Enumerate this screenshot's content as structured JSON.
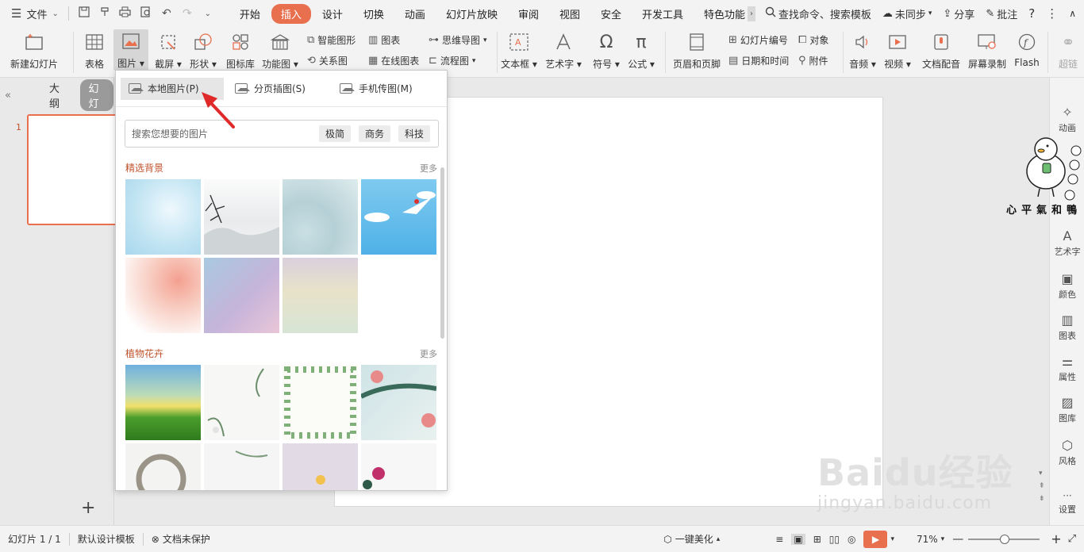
{
  "menubar": {
    "file_label": "文件",
    "tabs": [
      "开始",
      "插入",
      "设计",
      "切换",
      "动画",
      "幻灯片放映",
      "审阅",
      "视图",
      "安全",
      "开发工具",
      "特色功能"
    ],
    "active_tab": "插入",
    "search_placeholder": "查找命令、搜索模板",
    "sync_label": "未同步",
    "share_label": "分享",
    "comment_label": "批注"
  },
  "ribbon": {
    "new_slide": "新建幻灯片",
    "table": "表格",
    "picture": "图片",
    "screenshot": "截屏",
    "shape": "形状",
    "icon_lib": "图标库",
    "func_chart": "功能图",
    "smart_shape": "智能图形",
    "chart": "图表",
    "relation": "关系图",
    "online_chart": "在线图表",
    "mind_map": "思维导图",
    "flow_chart": "流程图",
    "text_box": "文本框",
    "art_text": "艺术字",
    "symbol": "符号",
    "formula": "公式",
    "header_footer": "页眉和页脚",
    "slide_number": "幻灯片编号",
    "object": "对象",
    "date_time": "日期和时间",
    "attachment": "附件",
    "audio": "音频",
    "video": "视频",
    "doc_voice": "文档配音",
    "screen_rec": "屏幕录制",
    "flash": "Flash",
    "hyperlink": "超链"
  },
  "left_panel": {
    "outline_tab": "大纲",
    "slides_tab": "幻灯",
    "slide_number": "1"
  },
  "dropdown": {
    "tab_local": "本地图片(P)",
    "tab_paged": "分页插图(S)",
    "tab_phone": "手机传图(M)",
    "search_placeholder": "搜索您想要的图片",
    "tags": [
      "极简",
      "商务",
      "科技"
    ],
    "section1_title": "精选背景",
    "section2_title": "植物花卉",
    "more_label": "更多"
  },
  "right_bar": {
    "items": [
      "动画",
      "艺术字",
      "颜色",
      "图表",
      "属性",
      "图库",
      "风格",
      "设置"
    ]
  },
  "statusbar": {
    "slide_info": "幻灯片 1 / 1",
    "template": "默认设计模板",
    "protection": "文档未保护",
    "beautify": "一键美化",
    "zoom": "71%"
  },
  "watermark": {
    "duck_caption": "心平气和鸭",
    "baidu_brand": "Baidu经验",
    "baidu_url": "jingyan.baidu.com"
  },
  "colors": {
    "accent": "#e8704f",
    "section_title": "#c0522b",
    "annotation_arrow": "#e02a2a"
  }
}
